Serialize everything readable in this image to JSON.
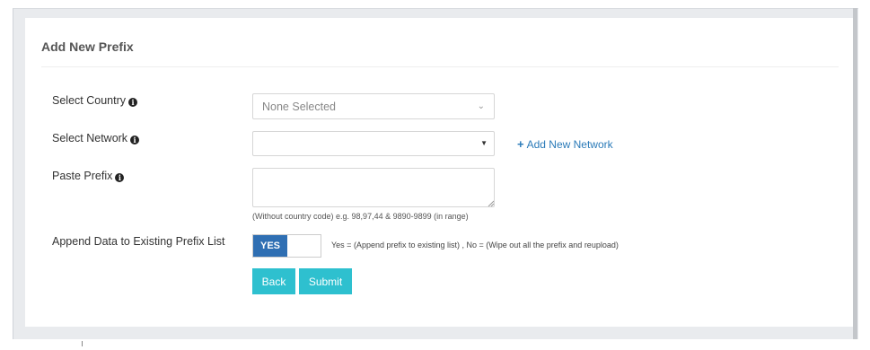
{
  "panel": {
    "title": "Add New Prefix"
  },
  "fields": {
    "country": {
      "label": "Select Country",
      "value": "None Selected",
      "info_icon": "info-circle-icon"
    },
    "network": {
      "label": "Select Network",
      "value": "",
      "info_icon": "info-circle-icon"
    },
    "prefix": {
      "label": "Paste Prefix",
      "value": "",
      "hint": "(Without country code) e.g. 98,97,44 & 9890-9899 (in range)",
      "info_icon": "info-circle-icon"
    },
    "append": {
      "label": "Append Data to Existing Prefix List",
      "toggle_value": "YES",
      "description": "Yes = (Append prefix to existing list) , No = (Wipe out all the prefix and reupload)"
    }
  },
  "links": {
    "add_network": "Add New Network",
    "add_network_icon": "plus-icon"
  },
  "buttons": {
    "back": "Back",
    "submit": "Submit"
  },
  "colors": {
    "accent_button": "#2ec0cf",
    "toggle_on": "#2f6fb3",
    "link": "#2a7ab8"
  }
}
